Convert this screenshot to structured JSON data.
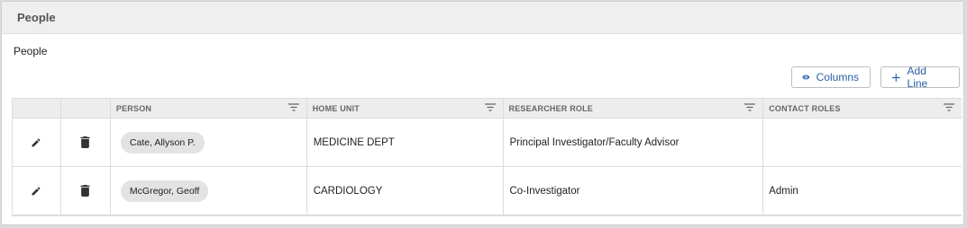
{
  "panel": {
    "title": "People"
  },
  "section": {
    "label": "People"
  },
  "toolbar": {
    "columns_label": "Columns",
    "add_line_label": "Add Line"
  },
  "table": {
    "headers": {
      "person": "PERSON",
      "home_unit": "HOME UNIT",
      "researcher_role": "RESEARCHER ROLE",
      "contact_roles": "CONTACT ROLES"
    },
    "rows": [
      {
        "person": "Cate, Allyson P.",
        "home_unit": "MEDICINE DEPT",
        "researcher_role": "Principal Investigator/Faculty Advisor",
        "contact_roles": ""
      },
      {
        "person": "McGregor, Geoff",
        "home_unit": "CARDIOLOGY",
        "researcher_role": "Co-Investigator",
        "contact_roles": "Admin"
      }
    ]
  },
  "icons": {
    "edit": "pencil-icon",
    "delete": "trash-icon",
    "filter": "filter-icon",
    "columns": "eye-icon",
    "add": "plus-icon"
  },
  "colors": {
    "accent": "#2a5fa8",
    "header_bg": "#efefef",
    "chip_bg": "#e3e3e3"
  }
}
